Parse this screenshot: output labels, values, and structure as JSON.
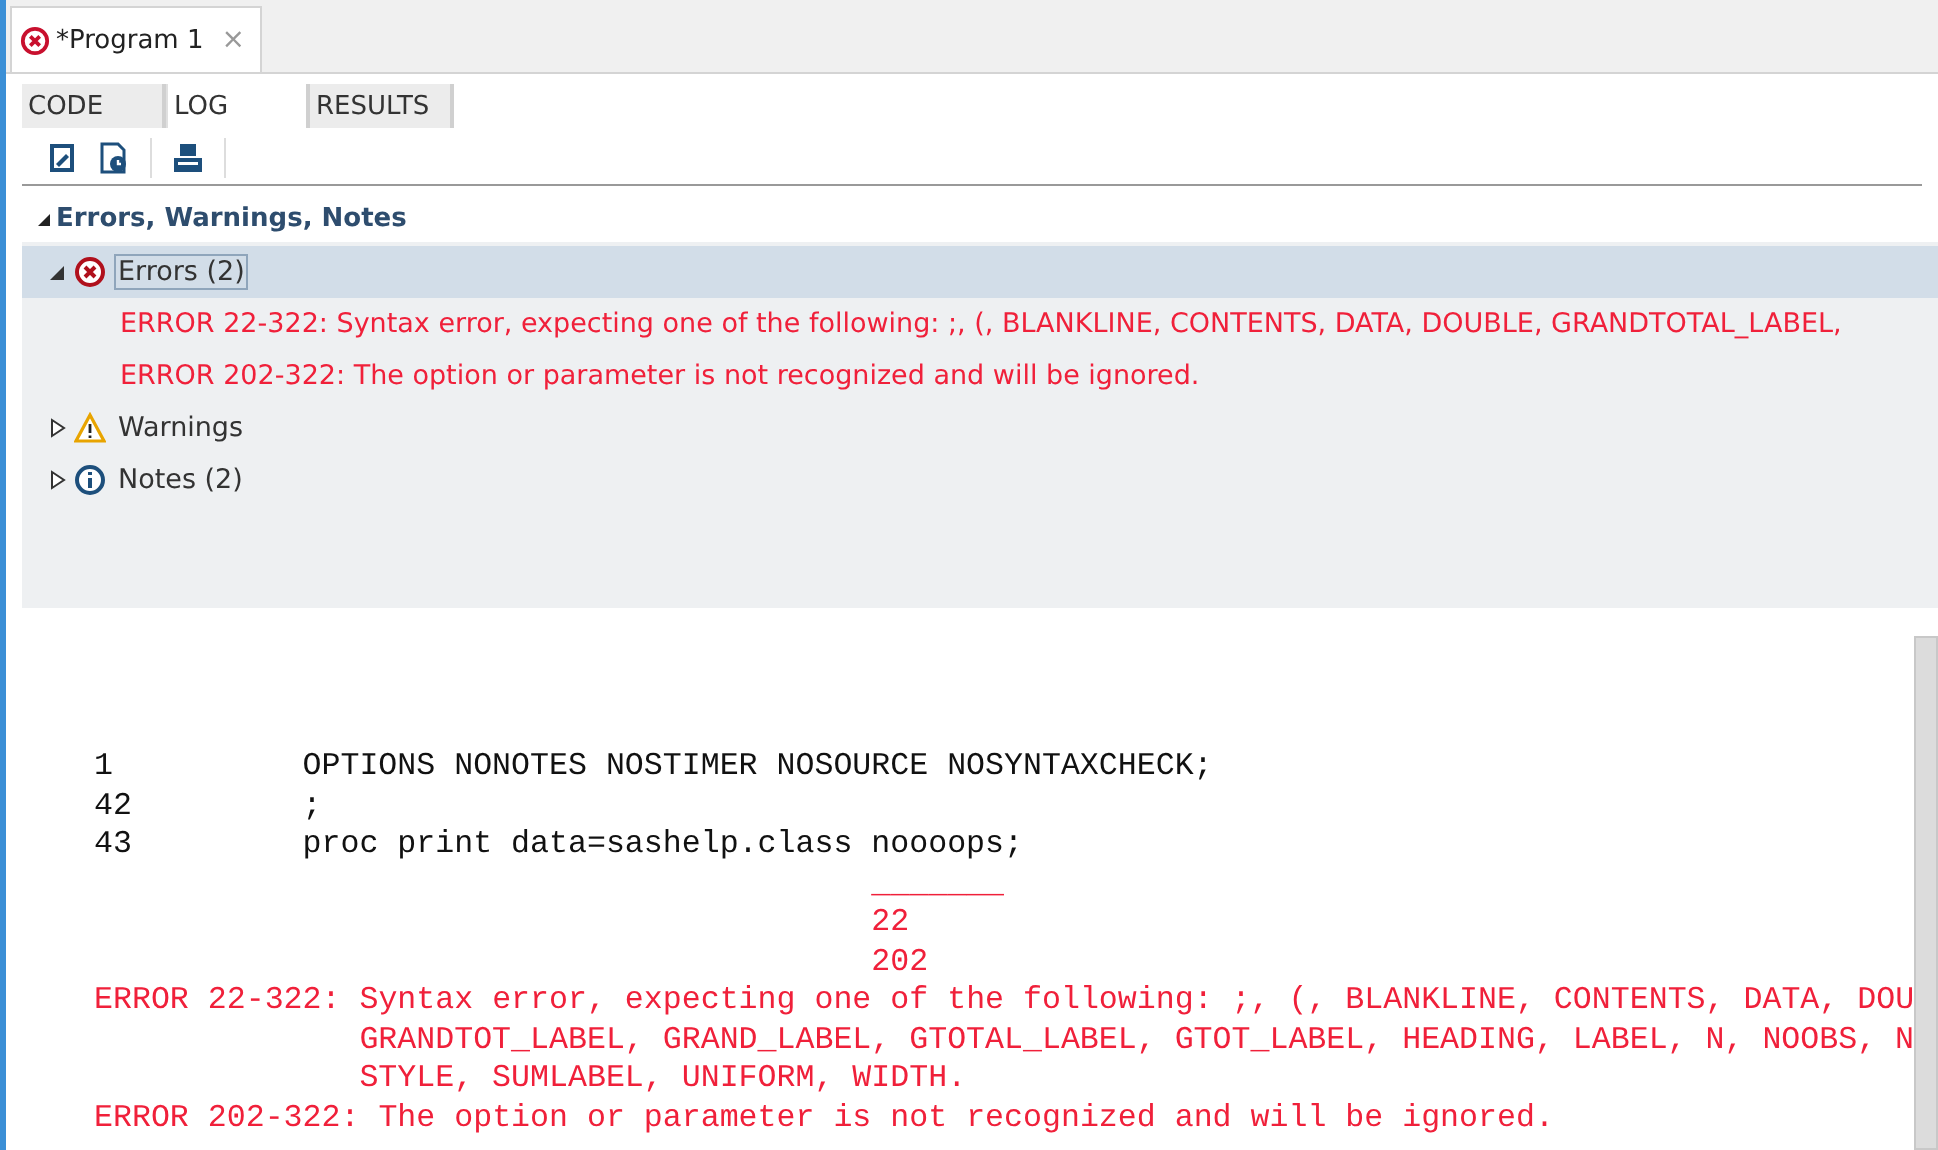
{
  "editor_tab": {
    "title": "*Program 1",
    "has_error": true,
    "close": "×"
  },
  "subtabs": [
    {
      "label": "CODE",
      "selected": false
    },
    {
      "label": "LOG",
      "selected": true
    },
    {
      "label": "RESULTS",
      "selected": false
    }
  ],
  "section": {
    "title": "Errors, Warnings, Notes",
    "expanded": true
  },
  "tree": [
    {
      "kind": "error",
      "label": "Errors (2)",
      "expanded": true,
      "selected": true,
      "children": [
        {
          "text": "ERROR 22-322: Syntax error, expecting one of the following: ;, (, BLANKLINE, CONTENTS, DATA, DOUBLE, GRANDTOTAL_LABEL,"
        },
        {
          "text": "ERROR 202-322: The option or parameter is not recognized and will be ignored."
        }
      ]
    },
    {
      "kind": "warning",
      "label": "Warnings",
      "expanded": false,
      "selected": false
    },
    {
      "kind": "note",
      "label": "Notes (2)",
      "expanded": false,
      "selected": false
    }
  ],
  "log_lines": [
    {
      "kind": "source",
      "number": "1",
      "text": "OPTIONS NONOTES NOSTIMER NOSOURCE NOSYNTAXCHECK;"
    },
    {
      "kind": "source",
      "number": "42",
      "text": ";"
    },
    {
      "kind": "source",
      "number": "43",
      "text": "proc print data=sashelp.class noooops;"
    },
    {
      "kind": "marker",
      "text": "_______"
    },
    {
      "kind": "marker",
      "text": "22"
    },
    {
      "kind": "marker",
      "text": "202"
    },
    {
      "kind": "error",
      "text": "ERROR 22-322: Syntax error, expecting one of the following: ;, (, BLANKLINE, CONTENTS, DATA, DOU"
    },
    {
      "kind": "continuation",
      "text": "GRANDTOT_LABEL, GRAND_LABEL, GTOTAL_LABEL, GTOT_LABEL, HEADING, LABEL, N, NOOBS, N"
    },
    {
      "kind": "continuation",
      "text": "STYLE, SUMLABEL, UNIFORM, WIDTH."
    },
    {
      "kind": "error",
      "text": "ERROR 202-322: The option or parameter is not recognized and will be ignored."
    }
  ]
}
